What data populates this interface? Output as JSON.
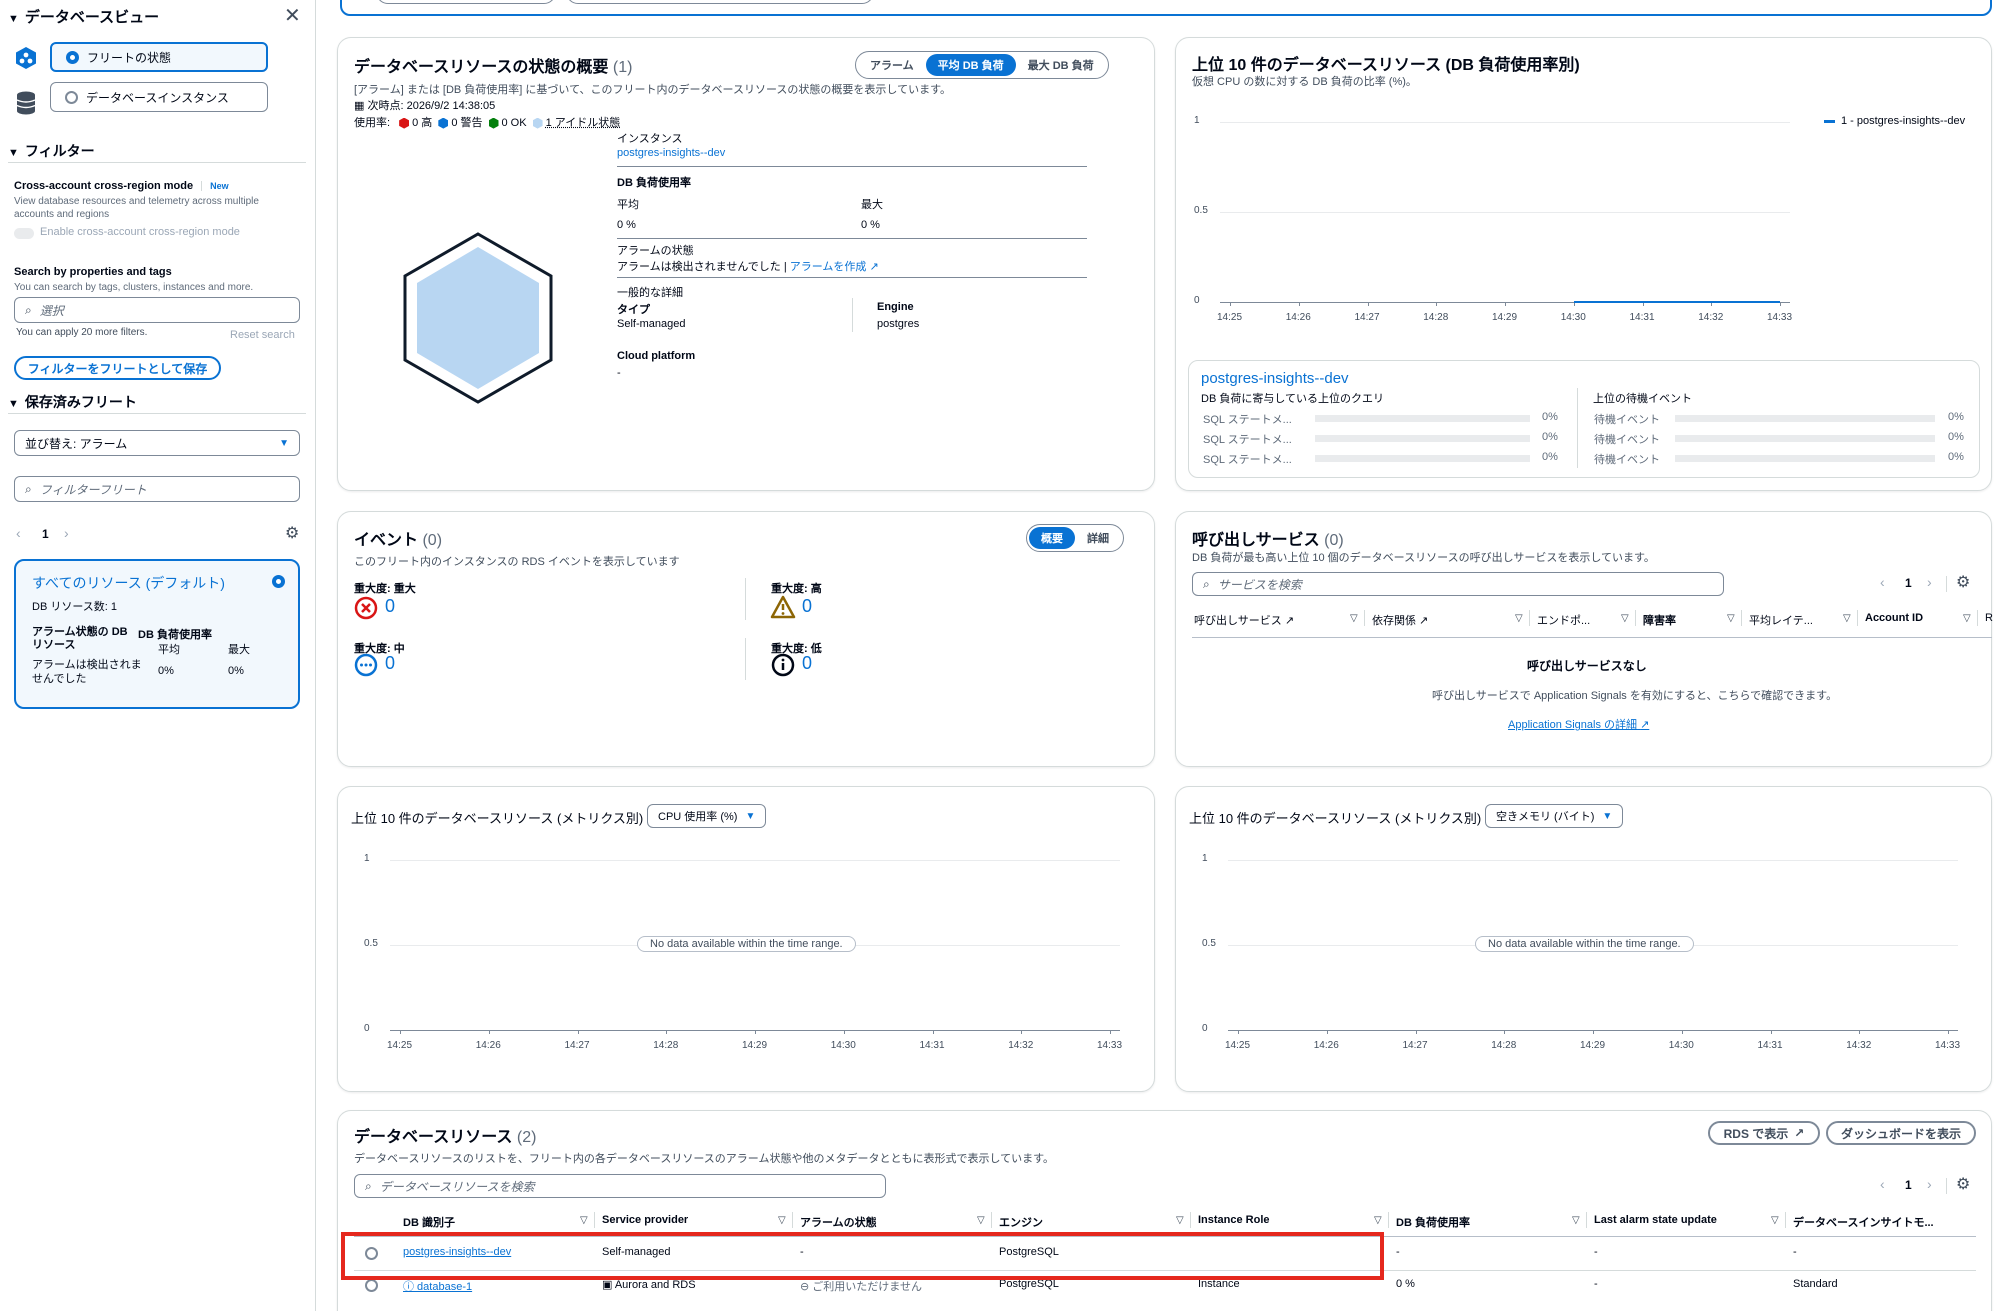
{
  "sidebar": {
    "title": "データベースビュー",
    "tabs": [
      "フリートの状態",
      "データベースインスタンス"
    ],
    "filter_heading": "フィルター",
    "cross_account_title": "Cross-account cross-region mode",
    "new_badge": "New",
    "cross_account_desc1": "View database resources and telemetry across multiple",
    "cross_account_desc2": "accounts and regions",
    "cross_account_toggle": "Enable cross-account cross-region mode",
    "search_title": "Search by properties and tags",
    "search_desc": "You can search by tags, clusters, instances and more.",
    "search_placeholder": "選択",
    "filters_hint": "You can apply 20 more filters.",
    "reset_search": "Reset search",
    "save_filter_button": "フィルターをフリートとして保存",
    "saved_heading": "保存済みフリート",
    "sort_select": "並び替え: アラーム",
    "fleet_filter_placeholder": "フィルターフリート",
    "page_number": "1",
    "fleet_card": {
      "title": "すべてのリソース (デフォルト)",
      "count_label": "DB リソース数: 1",
      "col1": "アラーム状態の DB リソース",
      "col2": "DB 負荷使用率",
      "avg": "平均",
      "max": "最大",
      "alarm_value": "アラームは検出されませんでした",
      "avg_value": "0%",
      "max_value": "0%"
    }
  },
  "health": {
    "title": "データベースリソースの状態の概要",
    "count": "(1)",
    "segments": [
      "アラーム",
      "平均 DB 負荷",
      "最大 DB 負荷"
    ],
    "desc": "[アラーム] または [DB 負荷使用率] に基づいて、このフリート内のデータベースリソースの状態の概要を表示しています。",
    "timestamp": "次時点: 2026/9/2 14:38:05",
    "usage_label": "使用率:",
    "legend": [
      "0 高",
      "0 警告",
      "0 OK",
      "1 アイドル状態"
    ],
    "legend_colors": [
      "#d91515",
      "#0972d3",
      "#037f0c",
      "#b8d6f2"
    ],
    "instance_label": "インスタンス",
    "instance_name": "postgres-insights--dev",
    "db_load_label": "DB 負荷使用率",
    "avg_label": "平均",
    "max_label": "最大",
    "avg_value": "0 %",
    "max_value": "0 %",
    "alarm_label": "アラームの状態",
    "alarm_value": "アラームは検出されませんでした |",
    "alarm_link": "アラームを作成",
    "general_label": "一般的な詳細",
    "type_label": "タイプ",
    "type_value": "Self-managed",
    "engine_label": "Engine",
    "engine_value": "postgres",
    "cloud_label": "Cloud platform",
    "cloud_value": "-"
  },
  "top10_load": {
    "title": "上位 10 件のデータベースリソース (DB 負荷使用率別)",
    "desc": "仮想 CPU の数に対する DB 負荷の比率 (%)。",
    "legend": "1 - postgres-insights--dev",
    "y_ticks": [
      "1",
      "0.5",
      "0"
    ],
    "x_ticks": [
      "14:25",
      "14:26",
      "14:27",
      "14:28",
      "14:29",
      "14:30",
      "14:31",
      "14:32",
      "14:33"
    ],
    "sub_title": "postgres-insights--dev",
    "queries_label": "DB 負荷に寄与している上位のクエリ",
    "waits_label": "上位の待機イベント",
    "query_rows": [
      "SQL ステートメ...",
      "SQL ステートメ...",
      "SQL ステートメ..."
    ],
    "wait_rows": [
      "待機イベント",
      "待機イベント",
      "待機イベント"
    ],
    "pct": "0%"
  },
  "events": {
    "title": "イベント",
    "count": "(0)",
    "segments": [
      "概要",
      "詳細"
    ],
    "desc": "このフリート内のインスタンスの RDS イベントを表示しています",
    "critical_label": "重大度: 重大",
    "high_label": "重大度: 高",
    "medium_label": "重大度: 中",
    "low_label": "重大度: 低",
    "critical": "0",
    "high": "0",
    "medium": "0",
    "low": "0"
  },
  "callers": {
    "title": "呼び出しサービス",
    "count": "(0)",
    "desc": "DB 負荷が最も高い上位 10 個のデータベースリソースの呼び出しサービスを表示しています。",
    "search_placeholder": "サービスを検索",
    "page_number": "1",
    "columns": [
      "呼び出しサービス",
      "依存関係",
      "エンドポ...",
      "障害率",
      "平均レイテ...",
      "Account ID",
      "R"
    ],
    "empty_title": "呼び出しサービスなし",
    "empty_desc": "呼び出しサービスで Application Signals を有効にすると、こちらで確認できます。",
    "empty_link": "Application Signals の詳細"
  },
  "metric_left": {
    "title": "上位 10 件のデータベースリソース (メトリクス別)",
    "select": "CPU 使用率 (%)",
    "nodata": "No data available within the time range.",
    "y_ticks": [
      "1",
      "0.5",
      "0"
    ],
    "x_ticks": [
      "14:25",
      "14:26",
      "14:27",
      "14:28",
      "14:29",
      "14:30",
      "14:31",
      "14:32",
      "14:33"
    ]
  },
  "metric_right": {
    "title": "上位 10 件のデータベースリソース (メトリクス別)",
    "select": "空きメモリ (バイト)",
    "nodata": "No data available within the time range.",
    "y_ticks": [
      "1",
      "0.5",
      "0"
    ],
    "x_ticks": [
      "14:25",
      "14:26",
      "14:27",
      "14:28",
      "14:29",
      "14:30",
      "14:31",
      "14:32",
      "14:33"
    ]
  },
  "resources": {
    "title": "データベースリソース",
    "count": "(2)",
    "desc": "データベースリソースのリストを、フリート内の各データベースリソースのアラーム状態や他のメタデータとともに表形式で表示しています。",
    "rds_button": "RDS で表示",
    "dashboard_button": "ダッシュボードを表示",
    "search_placeholder": "データベースリソースを検索",
    "page_number": "1",
    "columns": [
      "DB 識別子",
      "Service provider",
      "アラームの状態",
      "エンジン",
      "Instance Role",
      "DB 負荷使用率",
      "Last alarm state update",
      "データベースインサイトモ..."
    ],
    "rows": [
      [
        "postgres-insights--dev",
        "Self-managed",
        "-",
        "PostgreSQL",
        "",
        "-",
        "-",
        "-"
      ],
      [
        "database-1",
        "Aurora and RDS",
        "ご利用いただけません",
        "PostgreSQL",
        "Instance",
        "0 %",
        "-",
        "Standard"
      ]
    ]
  },
  "colors": {
    "accent": "#0972d3",
    "highlight": "#e5281d",
    "hex_fill": "#b8d6f2",
    "hex_stroke": "#0f1b2a"
  }
}
